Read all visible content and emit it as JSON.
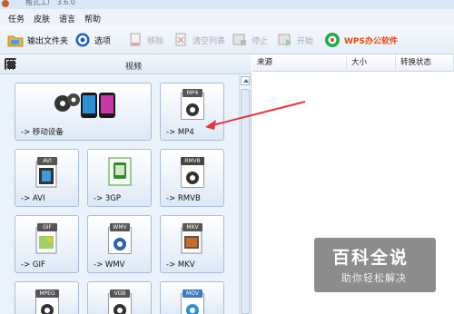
{
  "window": {
    "title": "格式工厂 3.6.0"
  },
  "menu": [
    "任务",
    "皮肤",
    "语言",
    "帮助"
  ],
  "toolbar": {
    "output_folder": "输出文件夹",
    "options": "选项",
    "remove": "移除",
    "clear_list": "清空列表",
    "stop": "停止",
    "start": "开始",
    "wps": "WPS办公软件"
  },
  "left_panel": {
    "title": "视频",
    "tiles": [
      {
        "label": "-> 移动设备"
      },
      {
        "label": "-> MP4",
        "badge": "MP4"
      },
      {
        "label": "-> AVI",
        "badge": "AVI"
      },
      {
        "label": "-> 3GP",
        "badge": "3GP"
      },
      {
        "label": "-> RMVB",
        "badge": "RMVB"
      },
      {
        "label": "-> GIF",
        "badge": "GIF"
      },
      {
        "label": "-> WMV",
        "badge": "WMV"
      },
      {
        "label": "-> MKV",
        "badge": "MKV"
      },
      {
        "label": "",
        "badge": "MPEG"
      },
      {
        "label": "",
        "badge": "VOB"
      },
      {
        "label": "",
        "badge": "MOV"
      }
    ]
  },
  "file_list": {
    "columns": [
      "来源",
      "大小",
      "转换状态"
    ]
  },
  "watermark": {
    "title": "百科全说",
    "subtitle": "助你轻松解决"
  },
  "colors": {
    "accent_arrow": "#e8333a",
    "wps_orange": "#e64a10"
  }
}
